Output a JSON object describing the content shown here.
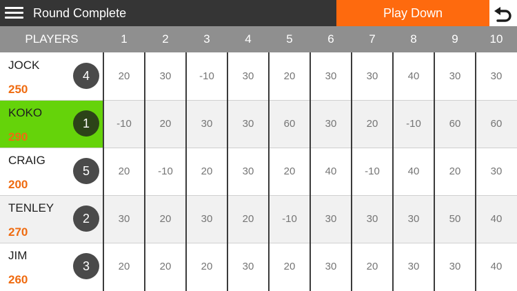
{
  "topbar": {
    "menu_icon": "hamburger-menu-icon",
    "title": "Round Complete",
    "play_down_label": "Play Down",
    "undo_icon": "undo-arrow-icon"
  },
  "table": {
    "players_header": "PLAYERS",
    "columns": [
      "1",
      "2",
      "3",
      "4",
      "5",
      "6",
      "7",
      "8",
      "9",
      "10"
    ],
    "players": [
      {
        "name": "JOCK",
        "total": "250",
        "rank": "4",
        "highlighted": false,
        "scores": [
          "20",
          "30",
          "-10",
          "30",
          "20",
          "30",
          "30",
          "40",
          "30",
          "30"
        ]
      },
      {
        "name": "KOKO",
        "total": "290",
        "rank": "1",
        "highlighted": true,
        "scores": [
          "-10",
          "20",
          "30",
          "30",
          "60",
          "30",
          "20",
          "-10",
          "60",
          "60"
        ]
      },
      {
        "name": "CRAIG",
        "total": "200",
        "rank": "5",
        "highlighted": false,
        "scores": [
          "20",
          "-10",
          "20",
          "30",
          "20",
          "40",
          "-10",
          "40",
          "20",
          "30"
        ]
      },
      {
        "name": "TENLEY",
        "total": "270",
        "rank": "2",
        "highlighted": false,
        "scores": [
          "30",
          "20",
          "30",
          "20",
          "-10",
          "30",
          "30",
          "30",
          "50",
          "40"
        ]
      },
      {
        "name": "JIM",
        "total": "260",
        "rank": "3",
        "highlighted": false,
        "scores": [
          "20",
          "20",
          "20",
          "30",
          "20",
          "30",
          "20",
          "30",
          "30",
          "40"
        ]
      }
    ]
  },
  "colors": {
    "topbar_bg": "#353535",
    "accent_orange": "#fe6a0e",
    "header_bg": "#8f8f8f",
    "highlight_green": "#65d30a",
    "rank_badge": "#4a4a4a",
    "rank_badge_highlight": "#2c4318",
    "score_total": "#ef6b10",
    "row_alt": "#f1f1f1"
  }
}
